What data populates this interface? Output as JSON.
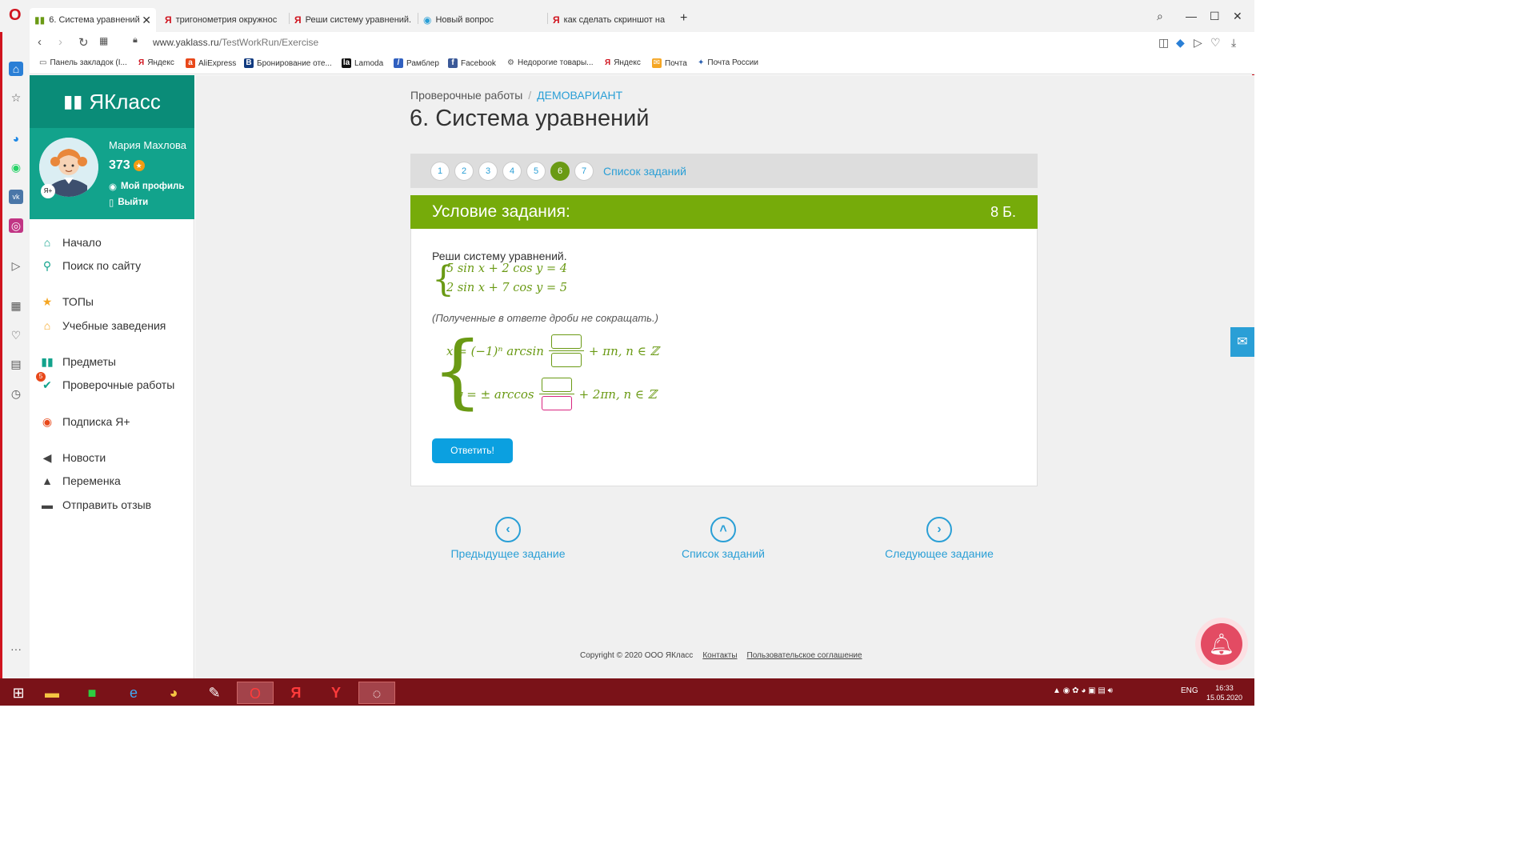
{
  "browser": {
    "tabs": [
      {
        "label": "6. Система уравнений",
        "active": true
      },
      {
        "label": "тригонометрия окружнос"
      },
      {
        "label": "Реши систему уравнений."
      },
      {
        "label": "Новый вопрос"
      },
      {
        "label": "как сделать скриншот на"
      }
    ],
    "url_host": "www.yaklass.ru",
    "url_path": "/TestWorkRun/Exercise",
    "bookmarks": [
      "Панель закладок (I...",
      "Яндекс",
      "AliExpress",
      "Бронирование оте...",
      "Lamoda",
      "Рамблер",
      "Facebook",
      "Недорогие товары...",
      "Яндекс",
      "Почта",
      "Почта России"
    ]
  },
  "site": {
    "brand": "ЯКласс",
    "user": {
      "name": "Мария Махлова",
      "score": "373",
      "profile_link": "Мой профиль",
      "logout_link": "Выйти"
    },
    "menu": [
      "Начало",
      "Поиск по сайту",
      "ТОПы",
      "Учебные заведения",
      "Предметы",
      "Проверочные работы",
      "Подписка Я+",
      "Новости",
      "Переменка",
      "Отправить отзыв"
    ],
    "menu_badge": "5"
  },
  "page": {
    "breadcrumb": [
      "Проверочные работы",
      "ДЕМОВАРИАНТ"
    ],
    "title": "6. Система уравнений",
    "pages": [
      "1",
      "2",
      "3",
      "4",
      "5",
      "6",
      "7"
    ],
    "active_page": "6",
    "task_list_link": "Список заданий",
    "task_header": "Условие задания:",
    "task_score": "8 Б.",
    "question": "Реши систему уравнений.",
    "equation_1": "5 sin x + 2 cos y = 4",
    "equation_2": "2 sin x + 7 cos y = 5",
    "note": "(Полученные в ответе дроби не сокращать.)",
    "solution_x_prefix": "x = (−1)ⁿ arcsin",
    "solution_x_suffix": "+ πn, n ∈ ℤ",
    "solution_y_prefix": "y = ± arccos",
    "solution_y_suffix": "+ 2πn, n ∈ ℤ",
    "answer_button": "Ответить!",
    "nav_prev": "Предыдущее задание",
    "nav_list": "Список заданий",
    "nav_next": "Следующее задание"
  },
  "footer": {
    "copyright": "Copyright © 2020 ООО ЯКласс",
    "contacts": "Контакты",
    "agreement": "Пользовательское соглашение"
  },
  "taskbar": {
    "lang": "ENG",
    "time": "16:33",
    "date": "15.05.2020"
  }
}
